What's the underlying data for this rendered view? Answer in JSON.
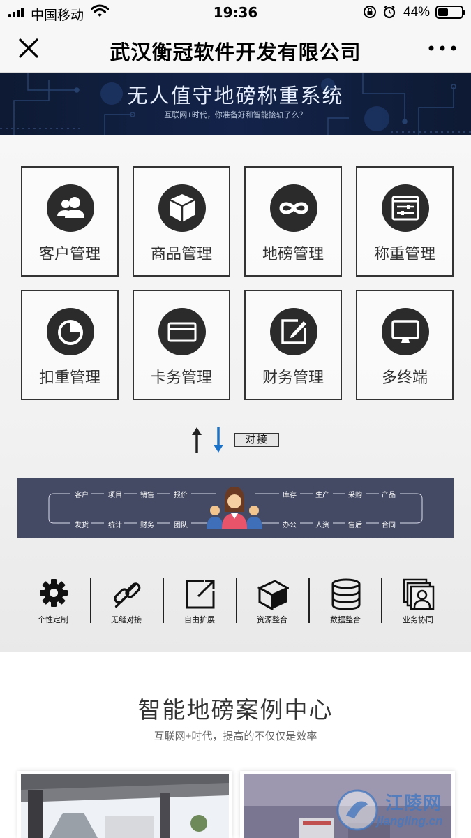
{
  "status_bar": {
    "carrier": "中国移动",
    "time": "19:36",
    "battery_percent": "44%",
    "battery_level": 0.44
  },
  "nav": {
    "title": "武汉衡冠软件开发有限公司",
    "close_icon": "close-icon",
    "more_icon": "more-icon"
  },
  "banner": {
    "title": "无人值守地磅称重系统",
    "subtitle": "互联网+时代，你准备好和智能接轨了么？"
  },
  "modules": [
    {
      "label": "客户管理",
      "icon": "users-icon"
    },
    {
      "label": "商品管理",
      "icon": "box-icon"
    },
    {
      "label": "地磅管理",
      "icon": "infinity-icon"
    },
    {
      "label": "称重管理",
      "icon": "sliders-icon"
    },
    {
      "label": "扣重管理",
      "icon": "pie-chart-icon"
    },
    {
      "label": "卡务管理",
      "icon": "card-icon"
    },
    {
      "label": "财务管理",
      "icon": "edit-icon"
    },
    {
      "label": "多终端",
      "icon": "monitor-icon"
    }
  ],
  "connect": {
    "label": "对接",
    "up_color": "#222222",
    "down_color": "#1a73c8"
  },
  "business_band": {
    "top_left": [
      "客户",
      "项目",
      "销售",
      "报价"
    ],
    "bottom_left": [
      "发货",
      "统计",
      "财务",
      "团队"
    ],
    "top_right": [
      "库存",
      "生产",
      "采购",
      "产品"
    ],
    "bottom_right": [
      "办公",
      "人资",
      "售后",
      "合同"
    ],
    "background": "#444a63"
  },
  "features": [
    {
      "label": "个性定制",
      "icon": "gear-icon"
    },
    {
      "label": "无缝对接",
      "icon": "link-icon"
    },
    {
      "label": "自由扩展",
      "icon": "expand-icon"
    },
    {
      "label": "资源整合",
      "icon": "cube-icon"
    },
    {
      "label": "数据整合",
      "icon": "database-icon"
    },
    {
      "label": "业务协同",
      "icon": "collaboration-icon"
    }
  ],
  "cases": {
    "title": "智能地磅案例中心",
    "subtitle": "互联网+时代，提高的不仅仅是效率"
  },
  "watermark": {
    "name": "江陵网",
    "url": "jiangling.cn"
  }
}
